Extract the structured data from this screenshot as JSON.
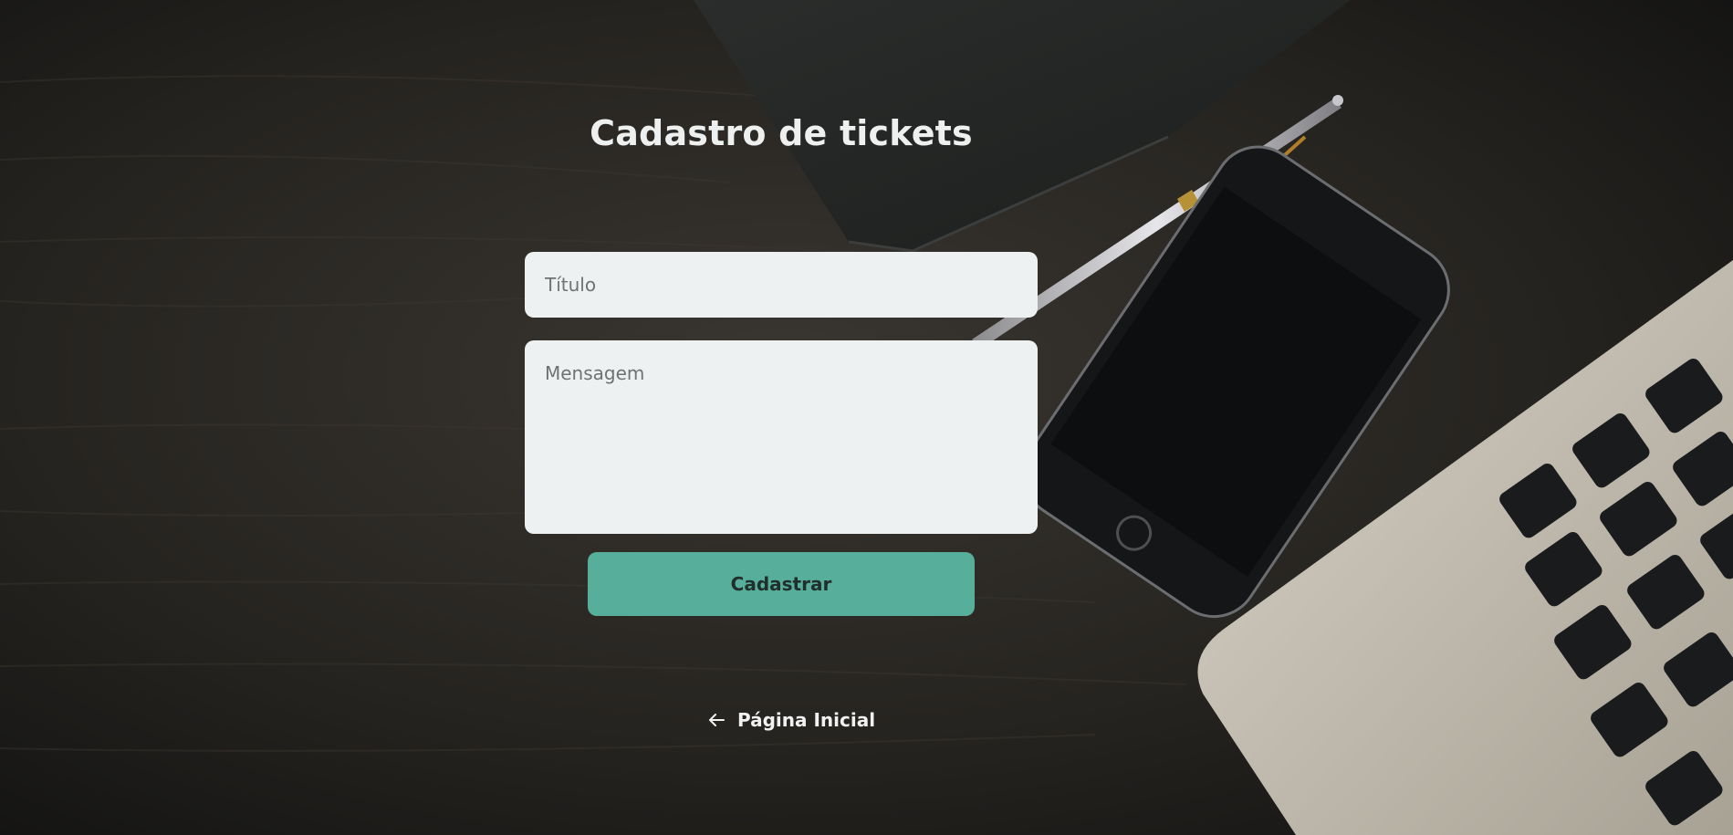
{
  "page": {
    "title": "Cadastro de tickets"
  },
  "form": {
    "title_placeholder": "Título",
    "message_placeholder": "Mensagem",
    "submit_label": "Cadastrar"
  },
  "nav": {
    "home_label": "Página Inicial",
    "home_icon": "arrow-left-icon"
  },
  "colors": {
    "accent": "#57ae9a",
    "field_background": "#eef1f1",
    "title_text": "#eef0ef"
  }
}
